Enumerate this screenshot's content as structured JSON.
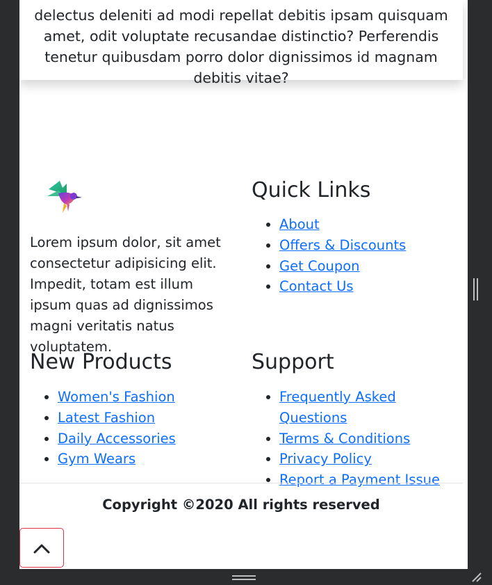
{
  "top_card": {
    "text": "delectus deleniti ad modi repellat debitis ipsam quisquam amet, odit voluptate recusandae distinctio? Perferendis tenetur quibusdam porro dolor dignissimos id magnam debitis vitae?"
  },
  "footer": {
    "about_text": "Lorem ipsum dolor, sit amet consectetur adipisicing elit. Impedit, totam est illum ipsum quas ad dignissimos magni veritatis natus voluptatem.",
    "quick_links": {
      "title": "Quick Links",
      "items": [
        {
          "label": "About"
        },
        {
          "label": "Offers & Discounts"
        },
        {
          "label": "Get Coupon"
        },
        {
          "label": "Contact Us"
        }
      ]
    },
    "new_products": {
      "title": "New Products",
      "items": [
        {
          "label": "Women's Fashion"
        },
        {
          "label": "Latest Fashion"
        },
        {
          "label": "Daily Accessories"
        },
        {
          "label": "Gym Wears"
        }
      ]
    },
    "support": {
      "title": "Support",
      "items": [
        {
          "label": "Frequently Asked Questions"
        },
        {
          "label": "Terms & Conditions"
        },
        {
          "label": "Privacy Policy"
        },
        {
          "label": "Report a Payment Issue"
        }
      ]
    },
    "copyright": "Copyright ©2020 All rights reserved"
  },
  "icons": {
    "logo": "hummingbird-logo-icon",
    "back_to_top": "chevron-up-icon"
  },
  "colors": {
    "link": "#0d6efd",
    "to_top_border": "#dc3545",
    "text": "#212529"
  }
}
